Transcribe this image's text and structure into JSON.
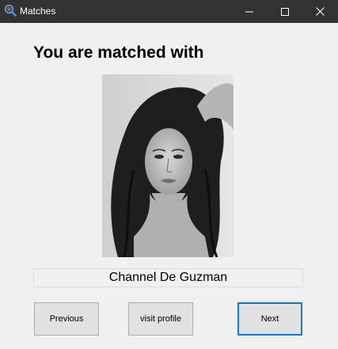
{
  "window": {
    "title": "Matches",
    "controls": {
      "minimize_icon": "minimize-icon",
      "maximize_icon": "maximize-icon",
      "close_icon": "close-icon"
    }
  },
  "main": {
    "heading": "You are matched with",
    "match_name": "Channel De Guzman",
    "photo_icon": "profile-photo"
  },
  "buttons": {
    "previous": "Previous",
    "visit_profile": "visit profile",
    "next": "Next"
  },
  "colors": {
    "titlebar": "#333333",
    "background": "#f0f0f0",
    "button": "#e1e1e1",
    "focus_border": "#0078d7"
  }
}
